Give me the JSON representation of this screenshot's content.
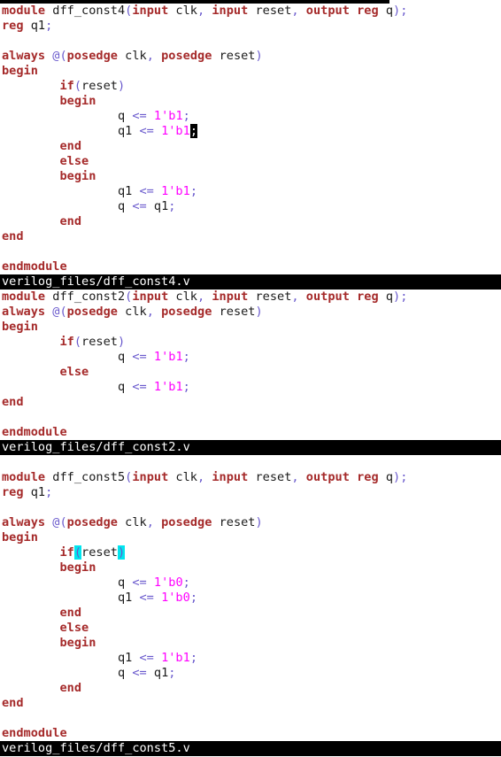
{
  "colors": {
    "keyword": "#a52a2a",
    "punctuation": "#6a5acd",
    "number": "#ff00ff",
    "text": "#1a1a1a",
    "status_bg": "#000000",
    "status_fg": "#ffffff",
    "match_bg": "#00e5ee"
  },
  "lines": [
    {
      "tokens": [
        {
          "t": "module",
          "c": "kw"
        },
        {
          "t": " dff_const4",
          "c": "text"
        },
        {
          "t": "(",
          "c": "punc"
        },
        {
          "t": "input",
          "c": "kw"
        },
        {
          "t": " clk",
          "c": "text"
        },
        {
          "t": ", ",
          "c": "punc"
        },
        {
          "t": "input",
          "c": "kw"
        },
        {
          "t": " reset",
          "c": "text"
        },
        {
          "t": ", ",
          "c": "punc"
        },
        {
          "t": "output",
          "c": "kw"
        },
        {
          "t": " ",
          "c": "text"
        },
        {
          "t": "reg",
          "c": "kw"
        },
        {
          "t": " q",
          "c": "text"
        },
        {
          "t": ");",
          "c": "punc"
        }
      ]
    },
    {
      "tokens": [
        {
          "t": "reg",
          "c": "kw"
        },
        {
          "t": " q1",
          "c": "text"
        },
        {
          "t": ";",
          "c": "punc"
        }
      ]
    },
    {
      "tokens": []
    },
    {
      "tokens": [
        {
          "t": "always",
          "c": "kw"
        },
        {
          "t": " ",
          "c": "text"
        },
        {
          "t": "@(",
          "c": "punc"
        },
        {
          "t": "posedge",
          "c": "kw"
        },
        {
          "t": " clk",
          "c": "text"
        },
        {
          "t": ", ",
          "c": "punc"
        },
        {
          "t": "posedge",
          "c": "kw"
        },
        {
          "t": " reset",
          "c": "text"
        },
        {
          "t": ")",
          "c": "punc"
        }
      ]
    },
    {
      "tokens": [
        {
          "t": "begin",
          "c": "kw"
        }
      ]
    },
    {
      "tokens": [
        {
          "t": "        ",
          "c": "text"
        },
        {
          "t": "if",
          "c": "kw"
        },
        {
          "t": "(",
          "c": "punc"
        },
        {
          "t": "reset",
          "c": "text"
        },
        {
          "t": ")",
          "c": "punc"
        }
      ]
    },
    {
      "tokens": [
        {
          "t": "        ",
          "c": "text"
        },
        {
          "t": "begin",
          "c": "kw"
        }
      ]
    },
    {
      "tokens": [
        {
          "t": "                q ",
          "c": "text"
        },
        {
          "t": "<=",
          "c": "punc"
        },
        {
          "t": " ",
          "c": "text"
        },
        {
          "t": "1'b1",
          "c": "num"
        },
        {
          "t": ";",
          "c": "punc"
        }
      ]
    },
    {
      "tokens": [
        {
          "t": "                q1 ",
          "c": "text"
        },
        {
          "t": "<=",
          "c": "punc"
        },
        {
          "t": " ",
          "c": "text"
        },
        {
          "t": "1'b1",
          "c": "num"
        },
        {
          "t": ";",
          "c": "cursor"
        }
      ]
    },
    {
      "tokens": [
        {
          "t": "        ",
          "c": "text"
        },
        {
          "t": "end",
          "c": "kw"
        }
      ]
    },
    {
      "tokens": [
        {
          "t": "        ",
          "c": "text"
        },
        {
          "t": "else",
          "c": "kw"
        }
      ]
    },
    {
      "tokens": [
        {
          "t": "        ",
          "c": "text"
        },
        {
          "t": "begin",
          "c": "kw"
        }
      ]
    },
    {
      "tokens": [
        {
          "t": "                q1 ",
          "c": "text"
        },
        {
          "t": "<=",
          "c": "punc"
        },
        {
          "t": " ",
          "c": "text"
        },
        {
          "t": "1'b1",
          "c": "num"
        },
        {
          "t": ";",
          "c": "punc"
        }
      ]
    },
    {
      "tokens": [
        {
          "t": "                q ",
          "c": "text"
        },
        {
          "t": "<=",
          "c": "punc"
        },
        {
          "t": " q1",
          "c": "text"
        },
        {
          "t": ";",
          "c": "punc"
        }
      ]
    },
    {
      "tokens": [
        {
          "t": "        ",
          "c": "text"
        },
        {
          "t": "end",
          "c": "kw"
        }
      ]
    },
    {
      "tokens": [
        {
          "t": "end",
          "c": "kw"
        }
      ]
    },
    {
      "tokens": []
    },
    {
      "tokens": [
        {
          "t": "endmodule",
          "c": "kw"
        }
      ]
    },
    {
      "status": "verilog_files/dff_const4.v"
    },
    {
      "tokens": [
        {
          "t": "module",
          "c": "kw"
        },
        {
          "t": " dff_const2",
          "c": "text"
        },
        {
          "t": "(",
          "c": "punc"
        },
        {
          "t": "input",
          "c": "kw"
        },
        {
          "t": " clk",
          "c": "text"
        },
        {
          "t": ", ",
          "c": "punc"
        },
        {
          "t": "input",
          "c": "kw"
        },
        {
          "t": " reset",
          "c": "text"
        },
        {
          "t": ", ",
          "c": "punc"
        },
        {
          "t": "output",
          "c": "kw"
        },
        {
          "t": " ",
          "c": "text"
        },
        {
          "t": "reg",
          "c": "kw"
        },
        {
          "t": " q",
          "c": "text"
        },
        {
          "t": ");",
          "c": "punc"
        }
      ]
    },
    {
      "tokens": [
        {
          "t": "always",
          "c": "kw"
        },
        {
          "t": " ",
          "c": "text"
        },
        {
          "t": "@(",
          "c": "punc"
        },
        {
          "t": "posedge",
          "c": "kw"
        },
        {
          "t": " clk",
          "c": "text"
        },
        {
          "t": ", ",
          "c": "punc"
        },
        {
          "t": "posedge",
          "c": "kw"
        },
        {
          "t": " reset",
          "c": "text"
        },
        {
          "t": ")",
          "c": "punc"
        }
      ]
    },
    {
      "tokens": [
        {
          "t": "begin",
          "c": "kw"
        }
      ]
    },
    {
      "tokens": [
        {
          "t": "        ",
          "c": "text"
        },
        {
          "t": "if",
          "c": "kw"
        },
        {
          "t": "(",
          "c": "punc"
        },
        {
          "t": "reset",
          "c": "text"
        },
        {
          "t": ")",
          "c": "punc"
        }
      ]
    },
    {
      "tokens": [
        {
          "t": "                q ",
          "c": "text"
        },
        {
          "t": "<=",
          "c": "punc"
        },
        {
          "t": " ",
          "c": "text"
        },
        {
          "t": "1'b1",
          "c": "num"
        },
        {
          "t": ";",
          "c": "punc"
        }
      ]
    },
    {
      "tokens": [
        {
          "t": "        ",
          "c": "text"
        },
        {
          "t": "else",
          "c": "kw"
        }
      ]
    },
    {
      "tokens": [
        {
          "t": "                q ",
          "c": "text"
        },
        {
          "t": "<=",
          "c": "punc"
        },
        {
          "t": " ",
          "c": "text"
        },
        {
          "t": "1'b1",
          "c": "num"
        },
        {
          "t": ";",
          "c": "punc"
        }
      ]
    },
    {
      "tokens": [
        {
          "t": "end",
          "c": "kw"
        }
      ]
    },
    {
      "tokens": []
    },
    {
      "tokens": [
        {
          "t": "endmodule",
          "c": "kw"
        }
      ]
    },
    {
      "status": "verilog_files/dff_const2.v"
    },
    {
      "tokens": []
    },
    {
      "tokens": [
        {
          "t": "module",
          "c": "kw"
        },
        {
          "t": " dff_const5",
          "c": "text"
        },
        {
          "t": "(",
          "c": "punc"
        },
        {
          "t": "input",
          "c": "kw"
        },
        {
          "t": " clk",
          "c": "text"
        },
        {
          "t": ", ",
          "c": "punc"
        },
        {
          "t": "input",
          "c": "kw"
        },
        {
          "t": " reset",
          "c": "text"
        },
        {
          "t": ", ",
          "c": "punc"
        },
        {
          "t": "output",
          "c": "kw"
        },
        {
          "t": " ",
          "c": "text"
        },
        {
          "t": "reg",
          "c": "kw"
        },
        {
          "t": " q",
          "c": "text"
        },
        {
          "t": ");",
          "c": "punc"
        }
      ]
    },
    {
      "tokens": [
        {
          "t": "reg",
          "c": "kw"
        },
        {
          "t": " q1",
          "c": "text"
        },
        {
          "t": ";",
          "c": "punc"
        }
      ]
    },
    {
      "tokens": []
    },
    {
      "tokens": [
        {
          "t": "always",
          "c": "kw"
        },
        {
          "t": " ",
          "c": "text"
        },
        {
          "t": "@(",
          "c": "punc"
        },
        {
          "t": "posedge",
          "c": "kw"
        },
        {
          "t": " clk",
          "c": "text"
        },
        {
          "t": ", ",
          "c": "punc"
        },
        {
          "t": "posedge",
          "c": "kw"
        },
        {
          "t": " reset",
          "c": "text"
        },
        {
          "t": ")",
          "c": "punc"
        }
      ]
    },
    {
      "tokens": [
        {
          "t": "begin",
          "c": "kw"
        }
      ]
    },
    {
      "tokens": [
        {
          "t": "        ",
          "c": "text"
        },
        {
          "t": "if",
          "c": "kw"
        },
        {
          "t": "(",
          "c": "match"
        },
        {
          "t": "reset",
          "c": "text"
        },
        {
          "t": ")",
          "c": "match"
        }
      ]
    },
    {
      "tokens": [
        {
          "t": "        ",
          "c": "text"
        },
        {
          "t": "begin",
          "c": "kw"
        }
      ]
    },
    {
      "tokens": [
        {
          "t": "                q ",
          "c": "text"
        },
        {
          "t": "<=",
          "c": "punc"
        },
        {
          "t": " ",
          "c": "text"
        },
        {
          "t": "1'b0",
          "c": "num"
        },
        {
          "t": ";",
          "c": "punc"
        }
      ]
    },
    {
      "tokens": [
        {
          "t": "                q1 ",
          "c": "text"
        },
        {
          "t": "<=",
          "c": "punc"
        },
        {
          "t": " ",
          "c": "text"
        },
        {
          "t": "1'b0",
          "c": "num"
        },
        {
          "t": ";",
          "c": "punc"
        }
      ]
    },
    {
      "tokens": [
        {
          "t": "        ",
          "c": "text"
        },
        {
          "t": "end",
          "c": "kw"
        }
      ]
    },
    {
      "tokens": [
        {
          "t": "        ",
          "c": "text"
        },
        {
          "t": "else",
          "c": "kw"
        }
      ]
    },
    {
      "tokens": [
        {
          "t": "        ",
          "c": "text"
        },
        {
          "t": "begin",
          "c": "kw"
        }
      ]
    },
    {
      "tokens": [
        {
          "t": "                q1 ",
          "c": "text"
        },
        {
          "t": "<=",
          "c": "punc"
        },
        {
          "t": " ",
          "c": "text"
        },
        {
          "t": "1'b1",
          "c": "num"
        },
        {
          "t": ";",
          "c": "punc"
        }
      ]
    },
    {
      "tokens": [
        {
          "t": "                q ",
          "c": "text"
        },
        {
          "t": "<=",
          "c": "punc"
        },
        {
          "t": " q1",
          "c": "text"
        },
        {
          "t": ";",
          "c": "punc"
        }
      ]
    },
    {
      "tokens": [
        {
          "t": "        ",
          "c": "text"
        },
        {
          "t": "end",
          "c": "kw"
        }
      ]
    },
    {
      "tokens": [
        {
          "t": "end",
          "c": "kw"
        }
      ]
    },
    {
      "tokens": []
    },
    {
      "tokens": [
        {
          "t": "endmodule",
          "c": "kw"
        }
      ]
    },
    {
      "status": "verilog_files/dff_const5.v"
    }
  ]
}
